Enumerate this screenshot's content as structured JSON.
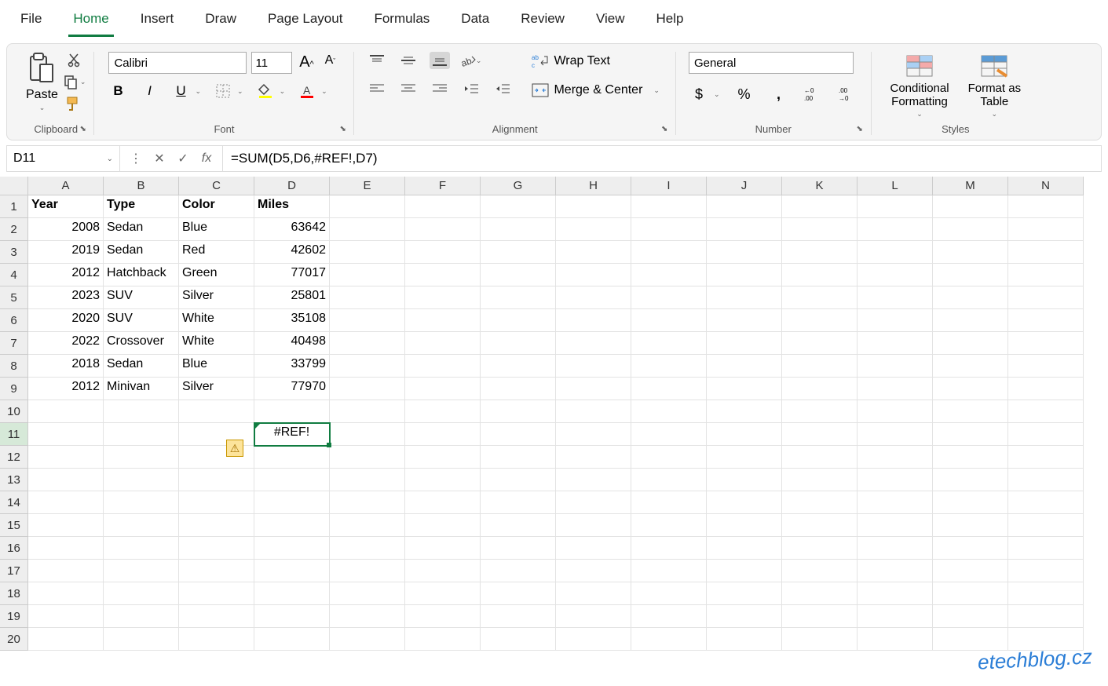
{
  "tabs": [
    "File",
    "Home",
    "Insert",
    "Draw",
    "Page Layout",
    "Formulas",
    "Data",
    "Review",
    "View",
    "Help"
  ],
  "activeTab": "Home",
  "groups": {
    "clipboard": {
      "label": "Clipboard",
      "paste": "Paste"
    },
    "font": {
      "label": "Font",
      "name": "Calibri",
      "size": "11"
    },
    "alignment": {
      "label": "Alignment",
      "wrap": "Wrap Text",
      "merge": "Merge & Center"
    },
    "number": {
      "label": "Number",
      "format": "General"
    },
    "styles": {
      "label": "Styles",
      "cond": "Conditional\nFormatting",
      "table": "Format as\nTable"
    }
  },
  "nameBox": "D11",
  "formula": "=SUM(D5,D6,#REF!,D7)",
  "columns": [
    "A",
    "B",
    "C",
    "D",
    "E",
    "F",
    "G",
    "H",
    "I",
    "J",
    "K",
    "L",
    "M",
    "N"
  ],
  "rowCount": 20,
  "selectedRow": 11,
  "headers": [
    "Year",
    "Type",
    "Color",
    "Miles"
  ],
  "data": [
    [
      2008,
      "Sedan",
      "Blue",
      63642
    ],
    [
      2019,
      "Sedan",
      "Red",
      42602
    ],
    [
      2012,
      "Hatchback",
      "Green",
      77017
    ],
    [
      2023,
      "SUV",
      "Silver",
      25801
    ],
    [
      2020,
      "SUV",
      "White",
      35108
    ],
    [
      2022,
      "Crossover",
      "White",
      40498
    ],
    [
      2018,
      "Sedan",
      "Blue",
      33799
    ],
    [
      2012,
      "Minivan",
      "Silver",
      77970
    ]
  ],
  "errorCell": {
    "row": 11,
    "col": "D",
    "value": "#REF!"
  },
  "watermark": "etechblog.cz"
}
